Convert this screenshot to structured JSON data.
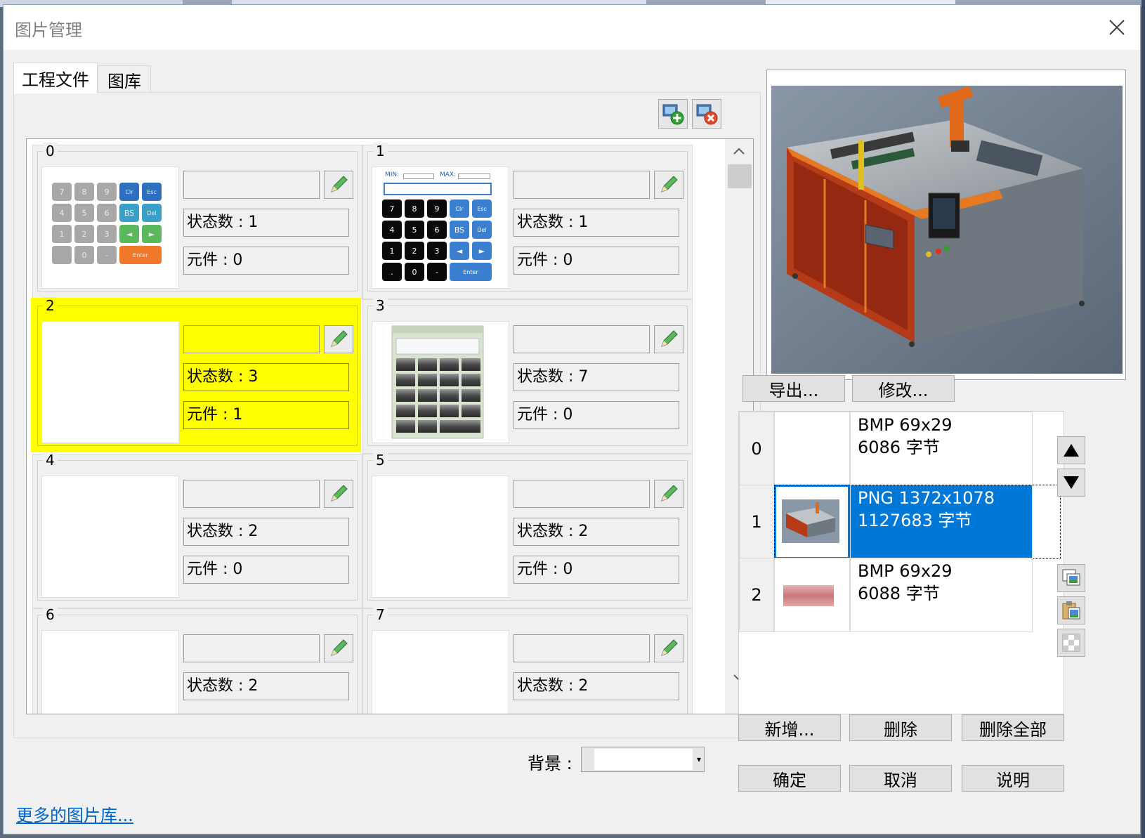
{
  "window": {
    "title": "图片管理",
    "close_label": "×"
  },
  "tabs": [
    {
      "label": "工程文件"
    },
    {
      "label": "图库"
    }
  ],
  "cells": [
    {
      "index": "0",
      "state_count": "状态数 : 1",
      "component_count": "元件 : 0"
    },
    {
      "index": "1",
      "state_count": "状态数 : 1",
      "component_count": "元件 : 0"
    },
    {
      "index": "2",
      "state_count": "状态数 : 3",
      "component_count": "元件 : 1"
    },
    {
      "index": "3",
      "state_count": "状态数 : 7",
      "component_count": "元件 : 0"
    },
    {
      "index": "4",
      "state_count": "状态数 : 2",
      "component_count": "元件 : 0"
    },
    {
      "index": "5",
      "state_count": "状态数 : 2",
      "component_count": "元件 : 0"
    },
    {
      "index": "6",
      "state_count": "状态数 : 2",
      "component_count": ""
    },
    {
      "index": "7",
      "state_count": "状态数 : 2",
      "component_count": ""
    }
  ],
  "keypad0": {
    "keys": [
      "7",
      "8",
      "9",
      "Clr",
      "Esc",
      "4",
      "5",
      "6",
      "BS",
      "Del",
      "1",
      "2",
      "3",
      "◄",
      "►",
      "",
      "0",
      "-",
      "Enter"
    ]
  },
  "keypad1": {
    "min_label": "MIN:",
    "max_label": "MAX:",
    "keys": [
      "7",
      "8",
      "9",
      "Clr",
      "Esc",
      "4",
      "5",
      "6",
      "BS",
      "Del",
      "1",
      "2",
      "3",
      "◄",
      "►",
      ".",
      "0",
      "-",
      "Enter"
    ]
  },
  "background": {
    "label": "背景 :",
    "value": ""
  },
  "link": {
    "label": "更多的图片库..."
  },
  "preview_buttons": {
    "export": "导出...",
    "modify": "修改..."
  },
  "image_list": [
    {
      "index": "0",
      "format": "BMP 69x29",
      "size": "6086 字节"
    },
    {
      "index": "1",
      "format": "PNG 1372x1078",
      "size": "1127683 字节"
    },
    {
      "index": "2",
      "format": "BMP 69x29",
      "size": "6088 字节"
    }
  ],
  "list_buttons": {
    "add": "新增...",
    "delete": "删除",
    "delete_all": "删除全部"
  },
  "footer_buttons": {
    "ok": "确定",
    "cancel": "取消",
    "help": "说明"
  },
  "colors": {
    "selected_cell": "#ffff00",
    "selected_row": "#0078d7",
    "link": "#0066cc"
  }
}
